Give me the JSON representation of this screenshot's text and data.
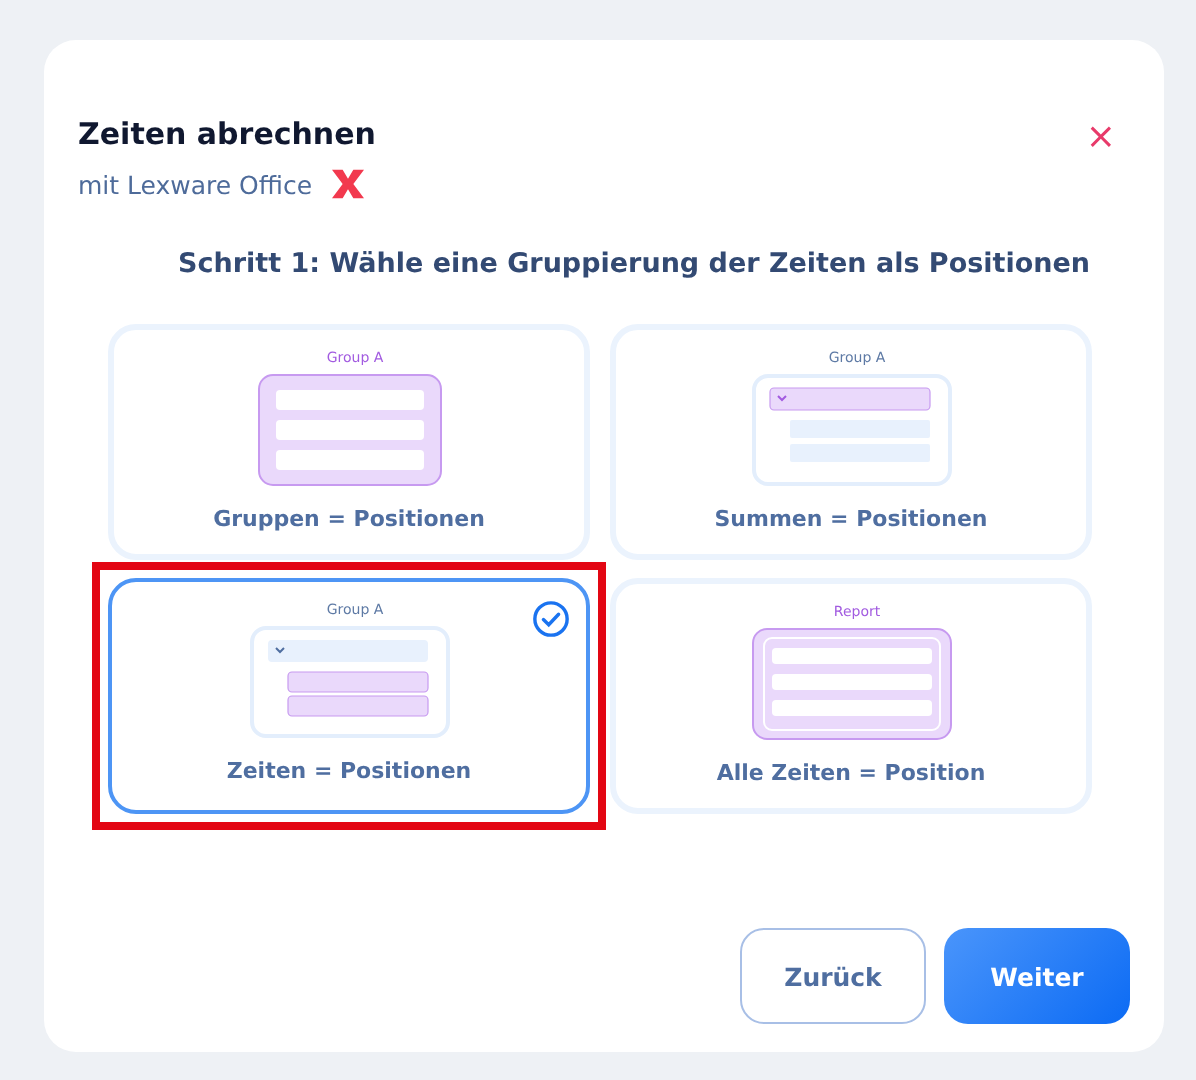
{
  "dialog": {
    "title": "Zeiten abrechnen",
    "subtitle": "mit Lexware Office",
    "close": "×"
  },
  "step_heading": "Schritt 1: Wähle eine Gruppierung der Zeiten als Positionen",
  "options": [
    {
      "kind": "groups",
      "caption": "Group A",
      "label": "Gruppen = Positionen",
      "selected": false,
      "highlighted": false
    },
    {
      "kind": "sums",
      "caption": "Group A",
      "label": "Summen = Positionen",
      "selected": false,
      "highlighted": false
    },
    {
      "kind": "times",
      "caption": "Group A",
      "label": "Zeiten = Positionen",
      "selected": true,
      "highlighted": true
    },
    {
      "kind": "report",
      "caption": "Report",
      "label": "Alle Zeiten = Position",
      "selected": false,
      "highlighted": false
    }
  ],
  "buttons": [
    {
      "kind": "secondary",
      "label": "Zurück"
    },
    {
      "kind": "primary",
      "label": "Weiter"
    }
  ]
}
